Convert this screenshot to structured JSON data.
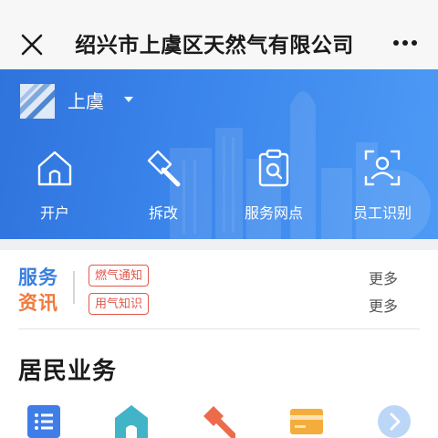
{
  "header": {
    "title": "绍兴市上虞区天然气有限公司",
    "close_icon": "close-icon",
    "more_icon": "more-dots-icon"
  },
  "banner": {
    "city": "上虞",
    "colors": {
      "gradient_start": "#2f73dc",
      "gradient_end": "#4d9af5"
    },
    "quick_actions": [
      {
        "label": "开户",
        "icon": "house-icon"
      },
      {
        "label": "拆改",
        "icon": "hammer-icon"
      },
      {
        "label": "服务网点",
        "icon": "clipboard-search-icon"
      },
      {
        "label": "员工识别",
        "icon": "face-scan-icon"
      }
    ]
  },
  "news": {
    "title_line1": "服务",
    "title_line2": "资讯",
    "items": [
      {
        "tag": "燃气通知",
        "more": "更多"
      },
      {
        "tag": "用气知识",
        "more": "更多"
      }
    ],
    "colors": {
      "blue": "#3a7ee0",
      "orange": "#f07a3c",
      "tag_red": "#e2574c"
    }
  },
  "residential": {
    "title": "居民业务",
    "icons": [
      "list-icon",
      "house-icon",
      "hammer-icon",
      "card-icon",
      "chevron-right-icon"
    ]
  }
}
